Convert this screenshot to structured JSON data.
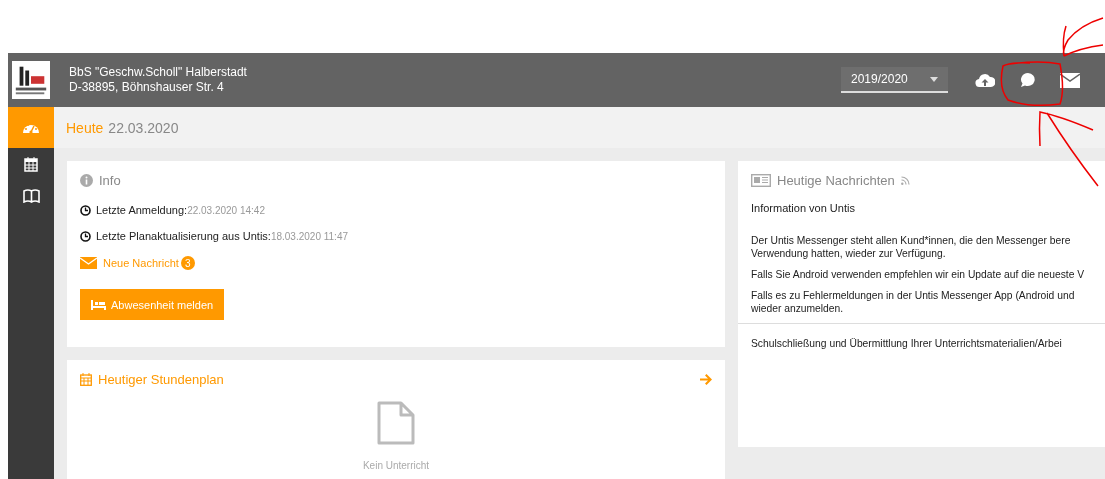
{
  "header": {
    "school_name": "BbS \"Geschw.Scholl\" Halberstadt",
    "address": "D-38895, Böhnshauser Str. 4",
    "year_select": {
      "value": "2019/2020"
    }
  },
  "sidebar": {
    "items": [
      {
        "kind": "dashboard",
        "selected": true
      },
      {
        "kind": "calendar",
        "selected": false
      },
      {
        "kind": "book",
        "selected": false
      }
    ]
  },
  "subheader": {
    "label": "Heute",
    "date": "22.03.2020"
  },
  "info": {
    "title": "Info",
    "rows": [
      {
        "label": "Letzte Anmeldung:",
        "value": "22.03.2020 14:42"
      },
      {
        "label": "Letzte Planaktualisierung aus Untis:",
        "value": "18.03.2020 11:47"
      }
    ],
    "messages": {
      "label": "Neue Nachricht",
      "count": "3"
    },
    "button": "Abwesenheit melden"
  },
  "timetable": {
    "title": "Heutiger Stundenplan",
    "empty_text": "Kein Unterricht"
  },
  "news": {
    "title": "Heutige Nachrichten",
    "items": [
      {
        "title": "Information von Untis",
        "paragraphs": [
          "Der Untis Messenger steht allen Kund*innen, die den Messenger bere",
          "Verwendung hatten, wieder zur Verfügung.",
          "Falls Sie Android verwenden empfehlen wir ein Update auf die neueste V",
          "Falls es zu Fehlermeldungen in der Untis Messenger App (Android und",
          "wieder anzumelden."
        ]
      },
      {
        "title": "Schulschließung und Übermittlung Ihrer Unterrichtsmaterialien/Arbei"
      }
    ]
  }
}
